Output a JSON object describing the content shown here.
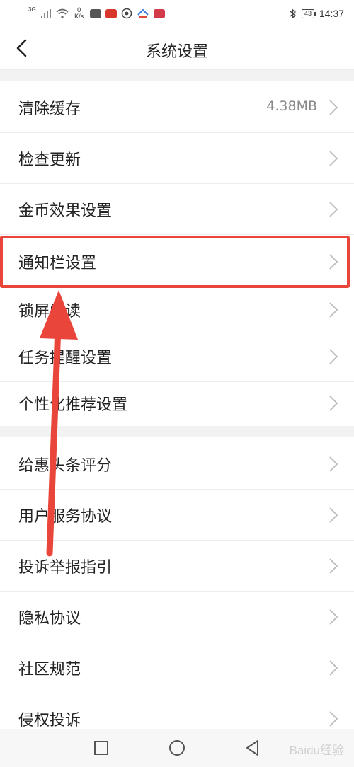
{
  "status_bar": {
    "network": "3G",
    "speed_value": "0",
    "speed_unit": "K/s",
    "battery": "43",
    "time": "14:37"
  },
  "header": {
    "title": "系统设置"
  },
  "sections": [
    {
      "items": [
        {
          "label": "清除缓存",
          "value": "4.38MB"
        },
        {
          "label": "检查更新"
        },
        {
          "label": "金币效果设置"
        },
        {
          "label": "通知栏设置"
        },
        {
          "label": "锁屏阅读"
        },
        {
          "label": "任务提醒设置"
        },
        {
          "label": "个性化推荐设置"
        }
      ]
    },
    {
      "items": [
        {
          "label": "给惠头条评分"
        },
        {
          "label": "用户服务协议"
        },
        {
          "label": "投诉举报指引"
        },
        {
          "label": "隐私协议"
        },
        {
          "label": "社区规范"
        },
        {
          "label": "侵权投诉"
        }
      ]
    }
  ],
  "colors": {
    "annotation": "#e9453a",
    "divider": "#ececec",
    "section_gap": "#f2f2f2",
    "value_text": "#888888"
  },
  "watermark": "Baidu经验"
}
